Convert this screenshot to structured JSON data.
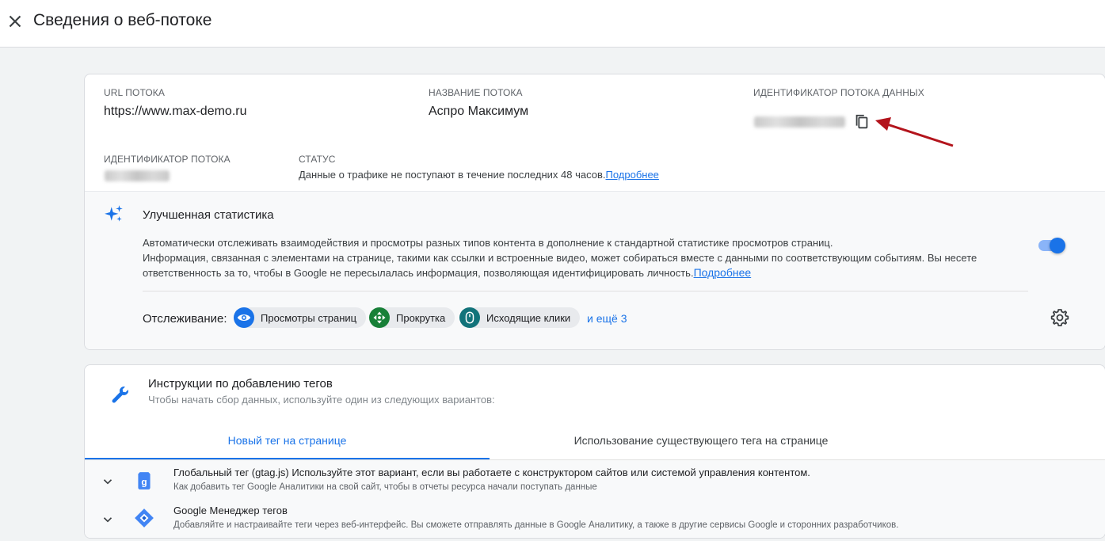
{
  "header": {
    "title": "Сведения о веб-потоке",
    "close_icon": "close-icon"
  },
  "stream": {
    "url_label": "URL ПОТОКА",
    "url_value": "https://www.max-demo.ru",
    "name_label": "НАЗВАНИЕ ПОТОКА",
    "name_value": "Аспро Максимум",
    "measurement_label": "ИДЕНТИФИКАТОР ПОТОКА ДАННЫХ",
    "stream_id_label": "ИДЕНТИФИКАТОР ПОТОКА",
    "status_label": "СТАТУС",
    "status_text": "Данные о трафике не поступают в течение последних 48 часов.",
    "status_link": "Подробнее"
  },
  "enhanced": {
    "title": "Улучшенная статистика",
    "desc_line1": "Автоматически отслеживать взаимодействия и просмотры разных типов контента в дополнение к стандартной статистике просмотров страниц.",
    "desc_line2": "Информация, связанная с элементами на странице, такими как ссылки и встроенные видео, может собираться вместе с данными по соответствующим событиям. Вы несете ответственность за то, чтобы в Google не пересылалась информация, позволяющая идентифицировать личность.",
    "desc_link": "Подробнее",
    "toggle_on": true,
    "tracking_label": "Отслеживание:",
    "chips": [
      {
        "label": "Просмотры страниц",
        "icon": "eye-icon",
        "color": "#1a73e8"
      },
      {
        "label": "Прокрутка",
        "icon": "scroll-icon",
        "color": "#188038"
      },
      {
        "label": "Исходящие клики",
        "icon": "mouse-icon",
        "color": "#12737a"
      }
    ],
    "more_link": "и ещё 3"
  },
  "instructions": {
    "title": "Инструкции по добавлению тегов",
    "subtitle": "Чтобы начать сбор данных, используйте один из следующих вариантов:",
    "tabs": [
      "Новый тег на странице",
      "Использование существующего тега на странице"
    ],
    "options": [
      {
        "title": "Глобальный тег (gtag.js)",
        "title_rest": " Используйте этот вариант, если вы работаете с конструктором сайтов или системой управления контентом.",
        "subtitle": "Как добавить тег Google Аналитики на свой сайт, чтобы в отчеты ресурса начали поступать данные",
        "icon": "gtag-icon"
      },
      {
        "title": "Google Менеджер тегов",
        "title_rest": "",
        "subtitle": "Добавляйте и настраивайте теги через веб-интерфейс. Вы сможете отправлять данные в Google Аналитику, а также в другие сервисы Google и сторонних разработчиков.",
        "icon": "gtm-icon"
      }
    ]
  },
  "colors": {
    "accent": "#1a73e8",
    "annotation_arrow": "#b3141c"
  }
}
